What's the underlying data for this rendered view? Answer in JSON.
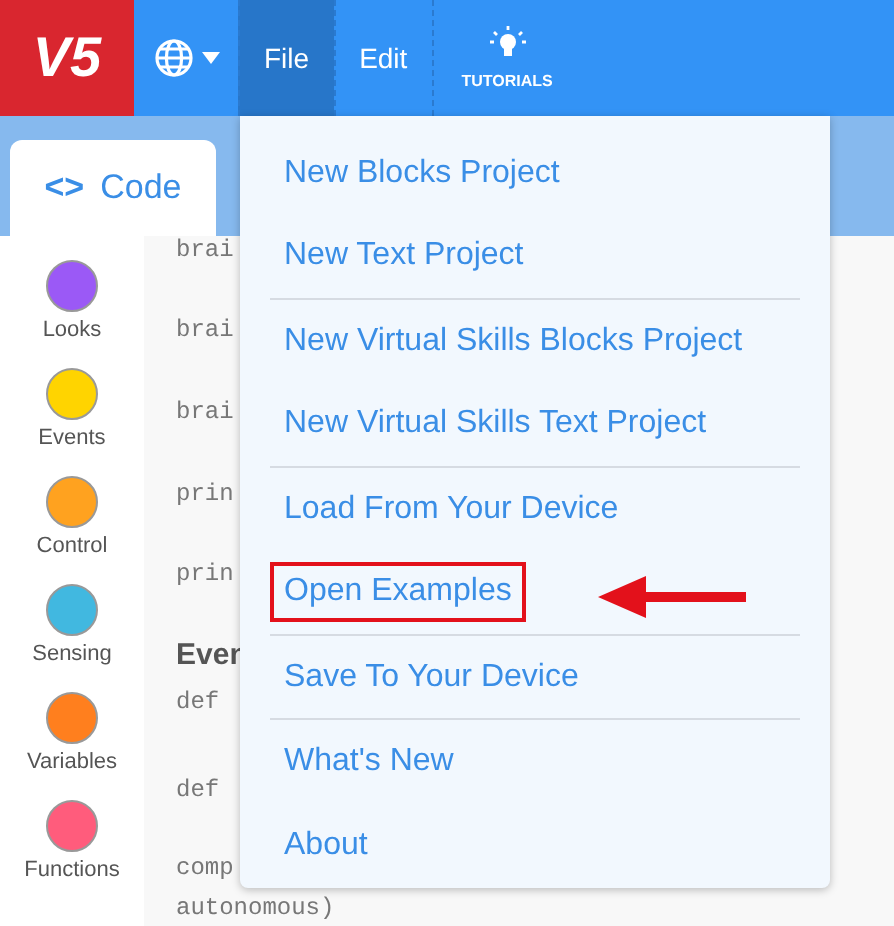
{
  "header": {
    "logo": "V5",
    "menus": [
      {
        "label": "File",
        "selected": true
      },
      {
        "label": "Edit",
        "selected": false
      }
    ],
    "tutorials": "TUTORIALS"
  },
  "code_tab": {
    "icon": "<>",
    "label": "Code"
  },
  "categories": [
    {
      "label": "Looks",
      "color": "#9b59f6"
    },
    {
      "label": "Events",
      "color": "#ffd400"
    },
    {
      "label": "Control",
      "color": "#ffa21f"
    },
    {
      "label": "Sensing",
      "color": "#41b8e0"
    },
    {
      "label": "Variables",
      "color": "#ff7f1e"
    },
    {
      "label": "Functions",
      "color": "#ff5c7c"
    }
  ],
  "code_lines": [
    {
      "kind": "code",
      "text": "brai"
    },
    {
      "kind": "code",
      "text": "brai"
    },
    {
      "kind": "code",
      "text": "brai"
    },
    {
      "kind": "code",
      "text": "prin"
    },
    {
      "kind": "code",
      "text": "prin"
    },
    {
      "kind": "heading",
      "text": "Even"
    },
    {
      "kind": "code",
      "text": "def"
    },
    {
      "kind": "code",
      "text": "def"
    },
    {
      "kind": "code",
      "text": "comp"
    },
    {
      "kind": "code",
      "text": "autonomous)"
    }
  ],
  "file_menu": [
    {
      "label": "New Blocks Project",
      "highlighted": false,
      "divider_after": false
    },
    {
      "label": "New Text Project",
      "highlighted": false,
      "divider_after": true
    },
    {
      "label": "New Virtual Skills Blocks Project",
      "highlighted": false,
      "divider_after": false
    },
    {
      "label": "New Virtual Skills Text Project",
      "highlighted": false,
      "divider_after": true
    },
    {
      "label": "Load From Your Device",
      "highlighted": false,
      "divider_after": false
    },
    {
      "label": "Open Examples",
      "highlighted": true,
      "divider_after": true
    },
    {
      "label": "Save To Your Device",
      "highlighted": false,
      "divider_after": true
    },
    {
      "label": "What's New",
      "highlighted": false,
      "divider_after": false
    },
    {
      "label": "About",
      "highlighted": false,
      "divider_after": false
    }
  ]
}
